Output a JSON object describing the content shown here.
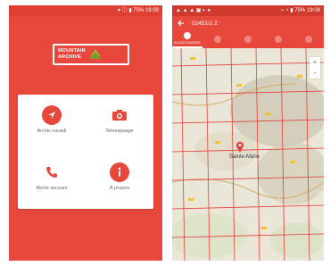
{
  "screen1": {
    "status_text": "▾ ⓘ ▮ 75% 19:09",
    "logo_text_line1": "MOUNTAIN",
    "logo_text_line2": "ARCHIVE",
    "menu": [
      {
        "label": "Archiv navadi",
        "icon": "navigation-arrow-icon"
      },
      {
        "label": "Teleexpeage",
        "icon": "camera-icon"
      },
      {
        "label": "Alerte secours",
        "icon": "phone-icon"
      },
      {
        "label": "À propos",
        "icon": "info-icon"
      }
    ]
  },
  "screen2": {
    "status_left": "▲ ▲ ▲ ▣ ◐ ●",
    "status_right": "⌁ ◔ ▮ 75% 19:09",
    "title": "02451/2.2",
    "tabs": [
      {
        "label": "ACCES RAPIDE",
        "active": true
      },
      {
        "label": "",
        "active": false
      },
      {
        "label": "",
        "active": false
      },
      {
        "label": "",
        "active": false
      },
      {
        "label": "",
        "active": false
      }
    ],
    "map": {
      "city_label": "Sainte-Marie",
      "zoom_in": "+",
      "zoom_out": "−"
    }
  },
  "colors": {
    "accent": "#e8473b",
    "grid": "#e53935",
    "map_bg": "#ebe7d8"
  }
}
